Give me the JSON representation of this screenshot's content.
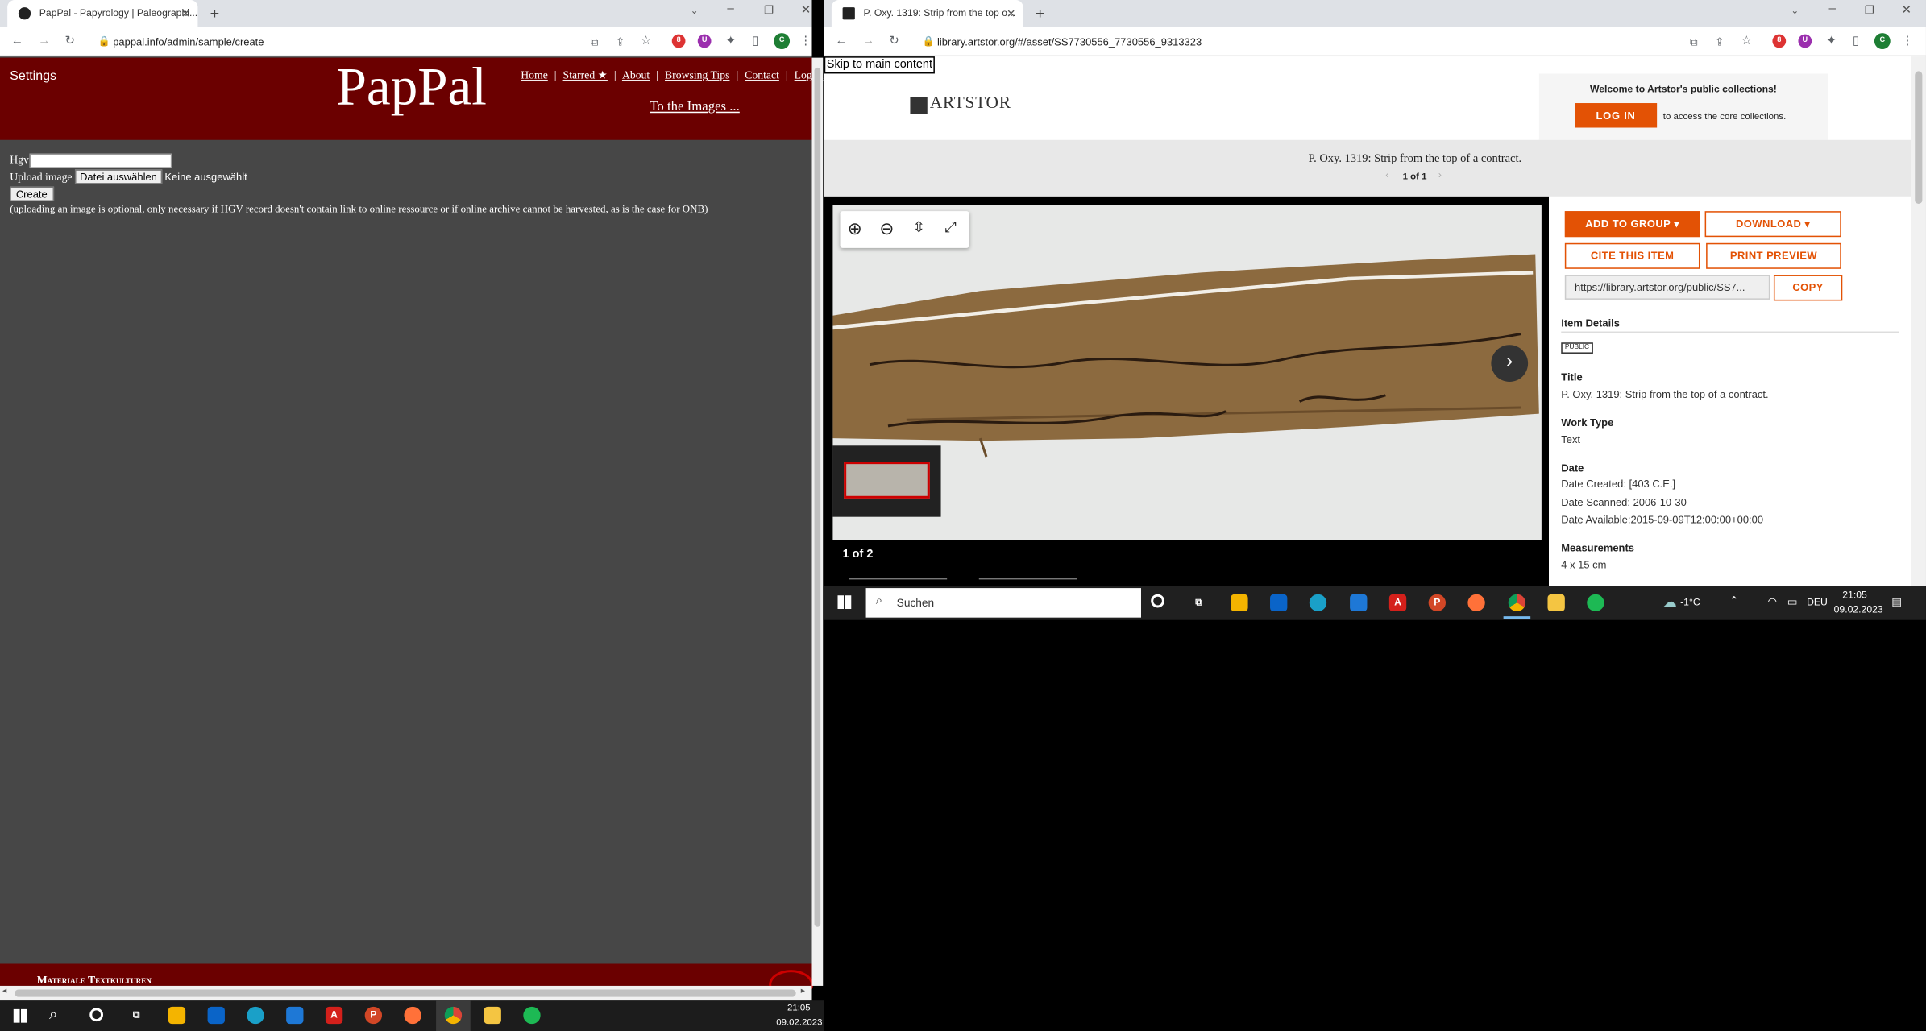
{
  "left": {
    "tab_title": "PapPal - Papyrology | Paleographi...",
    "url": "pappal.info/admin/sample/create",
    "settings": "Settings",
    "logo": "PapPal",
    "nav": [
      "Home",
      "Starred ★",
      "About",
      "Browsing Tips",
      "Contact",
      "Logou"
    ],
    "nav_sep": "|",
    "images_link": "To the Images ...",
    "form": {
      "hgv_label": "Hgv",
      "upload_label": "Upload image",
      "file_button": "Datei auswählen",
      "file_status": "Keine ausgewählt",
      "create_button": "Create",
      "note": "(uploading an image is optional, only necessary if HGV record doesn't contain link to online ressource or if online archive cannot be harvested, as is the case for ONB)"
    },
    "footer_text": "Materiale Textkulturen"
  },
  "right": {
    "tab_title": "P. Oxy. 1319: Strip from the top o...",
    "url": "library.artstor.org/#/asset/SS7730556_7730556_9313323",
    "skip_link": "Skip to main content",
    "brand": "ARTSTOR",
    "welcome": "Welcome to Artstor's public collections!",
    "login_button": "LOG IN",
    "login_suffix": "to access the core collections.",
    "asset_title": "P. Oxy. 1319: Strip from the top of a contract.",
    "pager": "1 of 1",
    "viewer_count": "1 of 2",
    "buttons": {
      "add_to_group": "ADD TO GROUP ▾",
      "download": "DOWNLOAD ▾",
      "cite": "CITE THIS ITEM",
      "print": "PRINT PREVIEW",
      "copy": "COPY"
    },
    "link_url": "https://library.artstor.org/public/SS7...",
    "details_heading": "Item Details",
    "public_badge": "PUBLIC",
    "fields": {
      "title_label": "Title",
      "title_value": "P. Oxy. 1319: Strip from the top of a contract.",
      "worktype_label": "Work Type",
      "worktype_value": "Text",
      "date_label": "Date",
      "date_created": "Date Created: [403 C.E.]",
      "date_scanned": "Date Scanned: 2006-10-30",
      "date_available": "Date Available:2015-09-09T12:00:00+00:00",
      "measure_label": "Measurements",
      "measure_value": "4 x 15 cm"
    }
  },
  "taskbar_inner": {
    "search": "Suchen",
    "weather": "-1°C",
    "lang": "DEU",
    "time": "21:05",
    "date": "09.02.2023"
  },
  "taskbar_outer": {
    "time": "21:05",
    "date": "09.02.2023"
  }
}
